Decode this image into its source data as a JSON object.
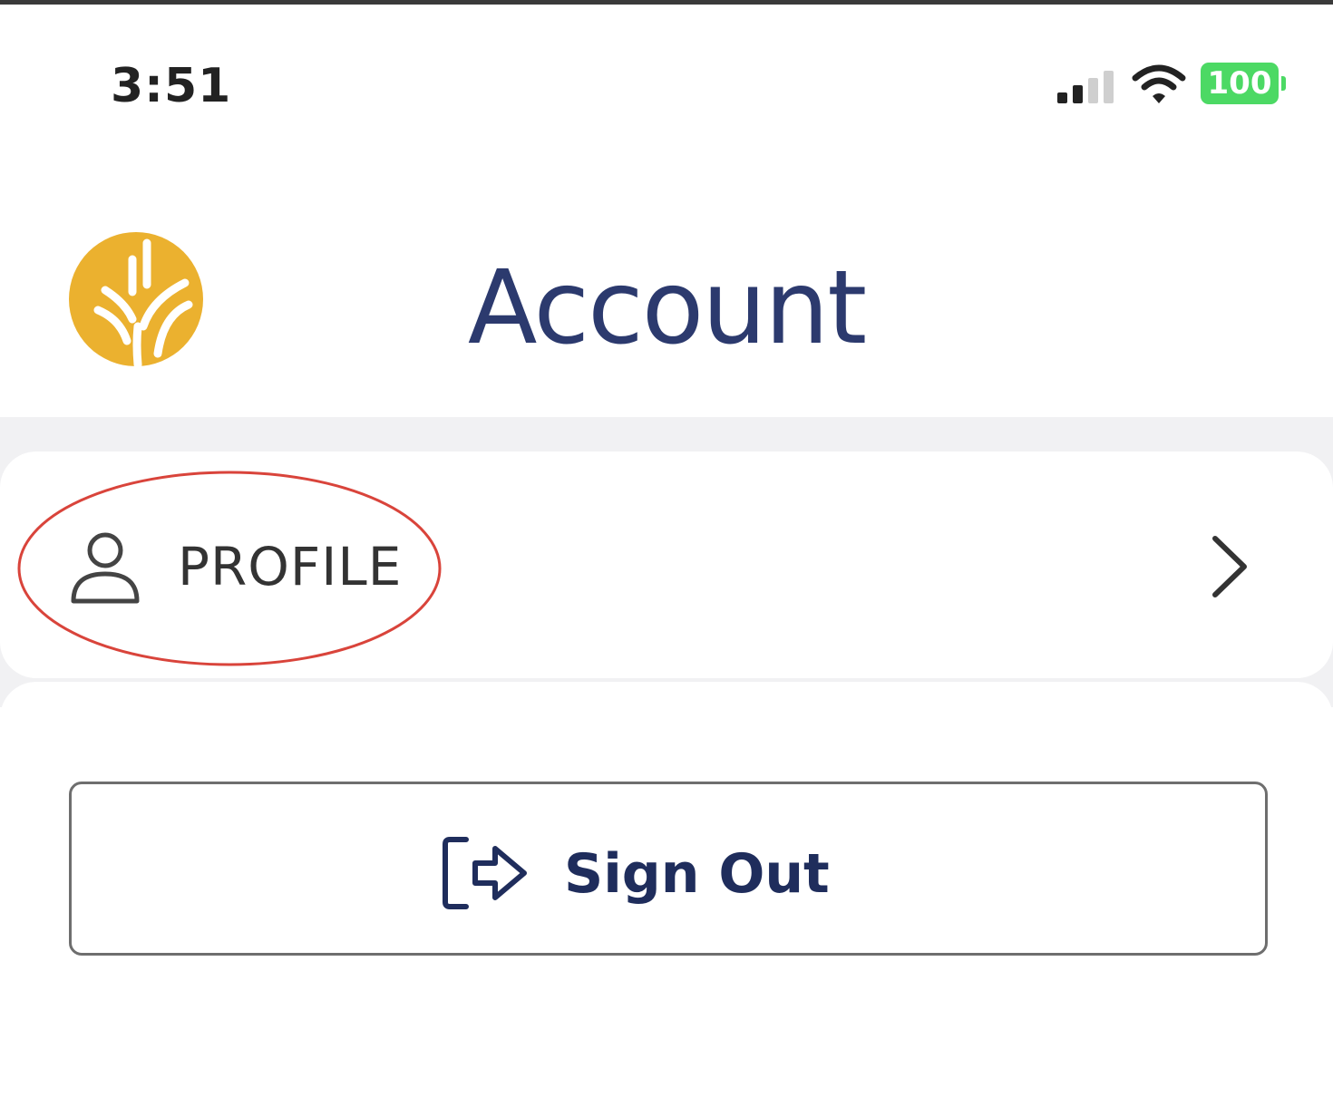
{
  "status_bar": {
    "time": "3:51",
    "battery_level": "100",
    "signal_bars_active": 2,
    "signal_bars_total": 4
  },
  "header": {
    "title": "Account"
  },
  "menu": {
    "profile_label": "PROFILE"
  },
  "actions": {
    "sign_out_label": "Sign Out"
  },
  "colors": {
    "brand_gold": "#ebb12f",
    "title_navy": "#2c3a6e",
    "button_navy": "#1f2d5c",
    "battery_green": "#4cd964",
    "highlight_red": "#d9443b"
  },
  "icons": {
    "logo": "wheat-logo-icon",
    "profile": "person-icon",
    "chevron": "chevron-right-icon",
    "sign_out": "sign-out-icon"
  }
}
